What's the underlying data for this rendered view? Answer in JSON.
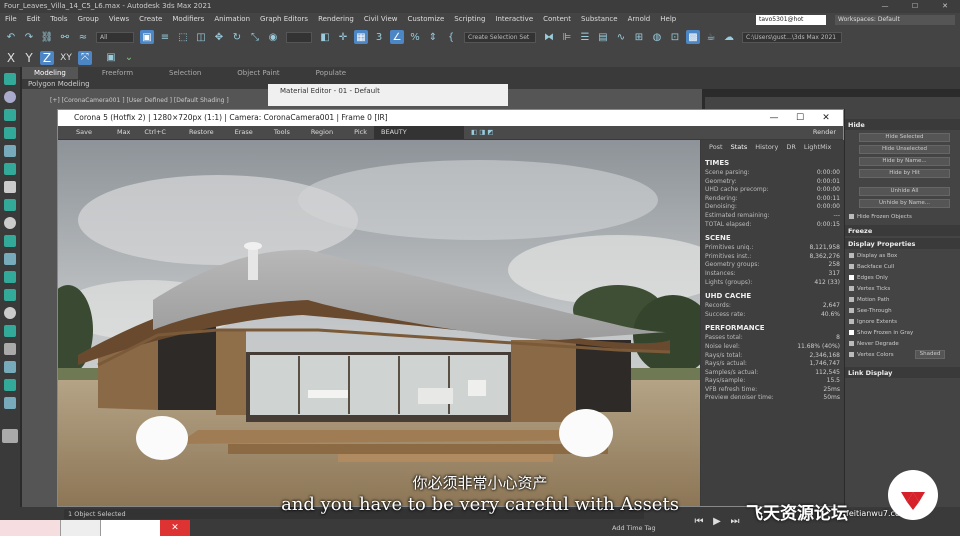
{
  "window": {
    "title": "Four_Leaves_Villa_14_C5_L6.max - Autodesk 3ds Max 2021"
  },
  "menu": [
    "File",
    "Edit",
    "Tools",
    "Group",
    "Views",
    "Create",
    "Modifiers",
    "Animation",
    "Graph Editors",
    "Rendering",
    "Civil View",
    "Customize",
    "Scripting",
    "Interactive",
    "Content",
    "Substance",
    "Arnold",
    "Help"
  ],
  "user": "tavo5301@hot",
  "workspaces": {
    "label": "Workspaces:",
    "value": "Default"
  },
  "toolbar": {
    "selection_filter": "All",
    "create_selection_set": "Create Selection Set",
    "axis_x": "X",
    "axis_y": "Y",
    "axis_z": "Z",
    "axis_xy": "XY",
    "path": "C:\\Users\\gust...\\3ds Max 2021"
  },
  "ribbon": {
    "tabs": [
      "Modeling",
      "Freeform",
      "Selection",
      "Object Paint",
      "Populate"
    ],
    "active": "Modeling",
    "sub": "Polygon Modeling"
  },
  "viewport_label": "[+] [CoronaCamera001 ] [User Defined ] [Default Shading ]",
  "material_editor": {
    "title": "Material Editor - 01 - Default"
  },
  "vfb": {
    "title": "Corona 5 (Hotfix 2) | 1280×720px (1:1) | Camera: CoronaCamera001 | Frame 0 [IR]",
    "tools": [
      "Save",
      "Max",
      "Ctrl+C",
      "Restore",
      "Erase",
      "Tools",
      "Region",
      "Pick",
      "BEAUTY"
    ],
    "render_button": "Render",
    "stat_tabs": [
      "Post",
      "Stats",
      "History",
      "DR",
      "LightMix"
    ],
    "times_header": "TIMES",
    "times": [
      [
        "Scene parsing:",
        "0:00:00"
      ],
      [
        "Geometry:",
        "0:00:01"
      ],
      [
        "UHD cache precomp:",
        "0:00:00"
      ],
      [
        "Rendering:",
        "0:00:11"
      ],
      [
        "Denoising:",
        "0:00:00"
      ],
      [
        "Estimated remaining:",
        "---"
      ],
      [
        "TOTAL elapsed:",
        "0:00:15"
      ]
    ],
    "scene_header": "SCENE",
    "scene": [
      [
        "Primitives uniq.:",
        "8,121,958"
      ],
      [
        "Primitives inst.:",
        "8,362,276"
      ],
      [
        "Geometry groups:",
        "258"
      ],
      [
        "Instances:",
        "317"
      ],
      [
        "Lights (groups):",
        "412 (33)"
      ]
    ],
    "uhd_header": "UHD CACHE",
    "uhd": [
      [
        "Records:",
        "2,647"
      ],
      [
        "Success rate:",
        "40.6%"
      ]
    ],
    "perf_header": "PERFORMANCE",
    "perf": [
      [
        "Passes total:",
        "8"
      ],
      [
        "Noise level:",
        "11.68% (40%)"
      ],
      [
        "Rays/s total:",
        "2,346,168"
      ],
      [
        "Rays/s actual:",
        "1,746,747"
      ],
      [
        "Samples/s actual:",
        "112,545"
      ],
      [
        "Rays/sample:",
        "15.5"
      ],
      [
        "VFB refresh time:",
        "25ms"
      ],
      [
        "Preview denoiser time:",
        "50ms"
      ]
    ]
  },
  "command_panel": {
    "hide_header": "Hide",
    "hide_buttons": [
      "Hide Selected",
      "Hide Unselected",
      "Hide by Name...",
      "Hide by Hit",
      "Unhide All",
      "Unhide by Name..."
    ],
    "hide_frozen": "Hide Frozen Objects",
    "freeze_header": "Freeze",
    "display_props_header": "Display Properties",
    "display_checks": [
      {
        "label": "Display as Box",
        "on": false
      },
      {
        "label": "Backface Cull",
        "on": false
      },
      {
        "label": "Edges Only",
        "on": true
      },
      {
        "label": "Vertex Ticks",
        "on": false
      },
      {
        "label": "Motion Path",
        "on": false
      },
      {
        "label": "See-Through",
        "on": false
      },
      {
        "label": "Ignore Extents",
        "on": false
      },
      {
        "label": "Show Frozen in Gray",
        "on": true
      },
      {
        "label": "Never Degrade",
        "on": false
      },
      {
        "label": "Vertex Colors",
        "on": false
      }
    ],
    "shaded_button": "Shaded",
    "link_display_header": "Link Display"
  },
  "status": {
    "text": "1 Object Selected",
    "add_time_tag": "Add Time Tag"
  },
  "subtitles": {
    "cn": "你必须非常小心资产",
    "en": "and you have to be very careful with Assets"
  },
  "watermark": {
    "text": "飞天资源论坛",
    "url": "feitianwu7.com"
  }
}
